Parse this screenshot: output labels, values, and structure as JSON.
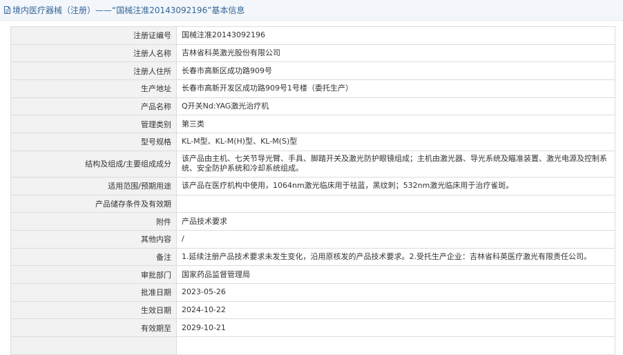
{
  "header": {
    "title": "境内医疗器械（注册）——“国械注准20143092196”基本信息"
  },
  "rows": [
    {
      "label": "注册证编号",
      "value": "国械注准20143092196"
    },
    {
      "label": "注册人名称",
      "value": "吉林省科英激光股份有限公司"
    },
    {
      "label": "注册人住所",
      "value": "长春市高新区成功路909号"
    },
    {
      "label": "生产地址",
      "value": "长春市高新开发区成功路909号1号楼（委托生产）"
    },
    {
      "label": "产品名称",
      "value": "Q开关Nd:YAG激光治疗机"
    },
    {
      "label": "管理类别",
      "value": "第三类"
    },
    {
      "label": "型号规格",
      "value": "KL-M型、KL-M(H)型、KL-M(S)型"
    },
    {
      "label": "结构及组成/主要组成成分",
      "value": "该产品由主机、七关节导光臂、手具、脚踏开关及激光防护眼镜组成；主机由激光器、导光系统及瞄准装置、激光电源及控制系统、安全防护系统和冷却系统组成。"
    },
    {
      "label": "适用范围/预期用途",
      "value": "该产品在医疗机构中使用，1064nm激光临床用于祛蓝，黑纹刺；532nm激光临床用于治疗雀斑。"
    },
    {
      "label": "产品储存条件及有效期",
      "value": ""
    },
    {
      "label": "附件",
      "value": "产品技术要求"
    },
    {
      "label": "其他内容",
      "value": "/"
    },
    {
      "label": "备注",
      "value": "1.延续注册产品技术要求未发生变化，沿用原核发的产品技术要求。2.受托生产企业：吉林省科英医疗激光有限责任公司。"
    },
    {
      "label": "审批部门",
      "value": "国家药品监督管理局"
    },
    {
      "label": "批准日期",
      "value": "2023-05-26"
    },
    {
      "label": "生效日期",
      "value": "2024-10-22"
    },
    {
      "label": "有效期至",
      "value": "2029-10-21"
    },
    {
      "label": "",
      "value": ""
    }
  ]
}
